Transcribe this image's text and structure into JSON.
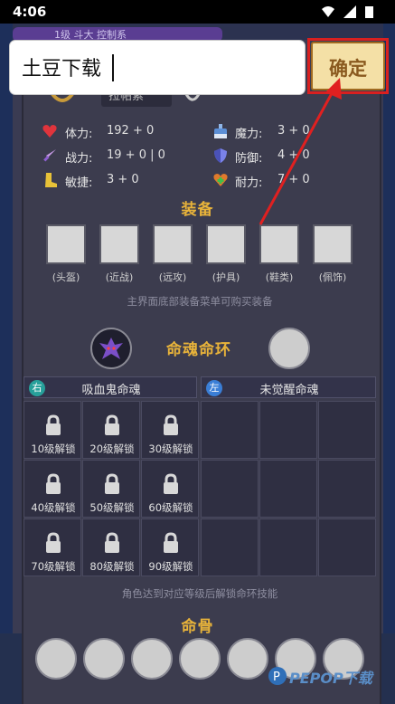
{
  "status_bar": {
    "time": "4:06"
  },
  "background": {
    "top_text": "1级 斗大 控制系"
  },
  "dialog": {
    "input_value": "土豆下载",
    "confirm_label": "确定"
  },
  "character": {
    "name_partial": "拉帕索"
  },
  "stats": [
    {
      "label": "体力:",
      "value": "192 + 0",
      "icon": "heart-icon"
    },
    {
      "label": "魔力:",
      "value": "3 + 0",
      "icon": "mana-bottle-icon"
    },
    {
      "label": "战力:",
      "value": "19 + 0 | 0",
      "icon": "sword-icon"
    },
    {
      "label": "防御:",
      "value": "4 + 0",
      "icon": "shield-icon"
    },
    {
      "label": "敏捷:",
      "value": "3 + 0",
      "icon": "boot-icon"
    },
    {
      "label": "耐力:",
      "value": "7 + 0",
      "icon": "endurance-heart-icon"
    }
  ],
  "equipment": {
    "title": "装备",
    "slots": [
      "(头盔)",
      "(近战)",
      "(远攻)",
      "(护具)",
      "(鞋类)",
      "(佩饰)"
    ],
    "hint": "主界面底部装备菜单可购买装备"
  },
  "soul_ring": {
    "title": "命魂命环",
    "right_badge": "右",
    "right_name": "吸血鬼命魂",
    "left_badge": "左",
    "left_name": "未觉醒命魂",
    "locks": [
      "10级解锁",
      "20级解锁",
      "30级解锁",
      "40级解锁",
      "50级解锁",
      "60级解锁",
      "70级解锁",
      "80级解锁",
      "90级解锁"
    ],
    "hint": "角色达到对应等级后解锁命环技能"
  },
  "bones": {
    "title": "命骨",
    "count": 7
  },
  "watermark": "PEPOP下载",
  "colors": {
    "accent": "#e8b33a",
    "confirm_border": "#d82020",
    "arrow": "#e02020"
  }
}
